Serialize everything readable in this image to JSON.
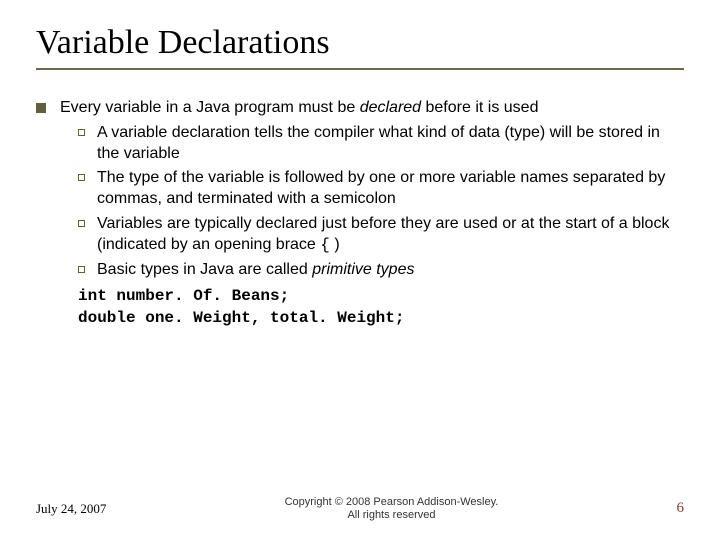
{
  "title": "Variable Declarations",
  "lvl1_pre": "Every variable in a Java program must be ",
  "lvl1_em": "declared",
  "lvl1_post": " before it is used",
  "sub": [
    "A variable declaration tells the compiler what kind of data (type) will be stored in the variable",
    "The type of the variable is followed by one or more variable names separated by commas, and terminated with a semicolon"
  ],
  "sub3_pre": "Variables are typically declared just before they are used or at the start of a block (indicated by an opening brace ",
  "sub3_code": "{",
  "sub3_post": " )",
  "sub4_pre": "Basic types in Java are called ",
  "sub4_em": "primitive types",
  "code": {
    "l1": "int number. Of. Beans;",
    "l2": "double one. Weight, total. Weight;"
  },
  "footer": {
    "date": "July 24, 2007",
    "copy1": "Copyright © 2008 Pearson Addison-Wesley.",
    "copy2": "All rights reserved",
    "page": "6"
  }
}
